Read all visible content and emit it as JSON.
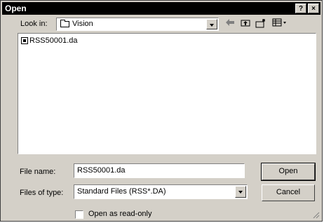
{
  "window": {
    "title": "Open",
    "help_label": "?",
    "close_label": "×"
  },
  "toolbar": {
    "look_in_label": "Look in:",
    "look_in_value": "Vision",
    "back_icon": "back-arrow-icon",
    "up_icon": "up-folder-icon",
    "new_folder_icon": "new-folder-icon",
    "view_menu_icon": "view-menu-icon"
  },
  "files": [
    {
      "name": "RSS50001.da",
      "icon": "data-file-icon"
    }
  ],
  "form": {
    "file_name_label": "File name:",
    "file_name_value": "RSS50001.da",
    "file_type_label": "Files of type:",
    "file_type_value": "Standard Files (RSS*.DA)",
    "readonly_label": "Open as read-only",
    "readonly_checked": false
  },
  "buttons": {
    "open_label": "Open",
    "cancel_label": "Cancel"
  }
}
